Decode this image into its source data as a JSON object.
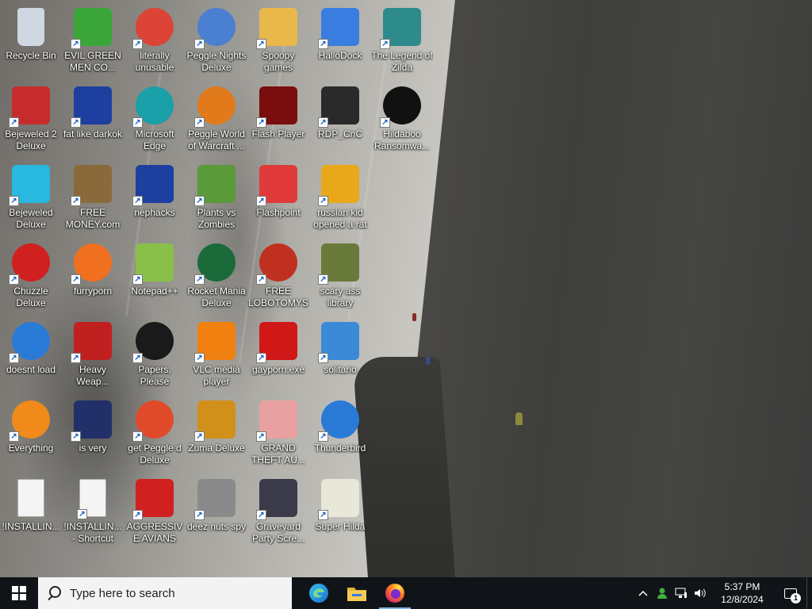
{
  "desktop": {
    "icons": [
      {
        "label": "Recycle Bin",
        "icon": "recycle-bin-icon",
        "color": "#cfd8e2"
      },
      {
        "label": "EVIL GREEN MEN CO...",
        "icon": "green-men-icon",
        "color": "#3aa63a"
      },
      {
        "label": "literally unusable",
        "icon": "chrome-icon",
        "color": "#db4437"
      },
      {
        "label": "Peggle Nights Deluxe",
        "icon": "peggle-icon",
        "color": "#4b7fd1"
      },
      {
        "label": "Spoopy games",
        "icon": "folder-icon",
        "color": "#e8b84a"
      },
      {
        "label": "HalloDock",
        "icon": "shield-icon",
        "color": "#3a7de0"
      },
      {
        "label": "The Legend of Zilda",
        "icon": "zilda-icon",
        "color": "#2e8b8b"
      },
      {
        "label": "Bejeweled 2 Deluxe",
        "icon": "bejeweled2-icon",
        "color": "#c72c2c"
      },
      {
        "label": "fat like darkok",
        "icon": "mpl-icon",
        "color": "#1c3fa0"
      },
      {
        "label": "Microsoft Edge",
        "icon": "edge-icon",
        "color": "#1aa0a8"
      },
      {
        "label": "Peggle World of Warcraft ...",
        "icon": "peggle-wow-icon",
        "color": "#e07a1a"
      },
      {
        "label": "Flash Player",
        "icon": "flash-icon",
        "color": "#7a0d0d"
      },
      {
        "label": "RDP_CnC",
        "icon": "rdp-icon",
        "color": "#2a2a2a"
      },
      {
        "label": "Hildaboo Ransomwa...",
        "icon": "yashma-icon",
        "color": "#111111"
      },
      {
        "label": "Bejeweled Deluxe",
        "icon": "diamond-icon",
        "color": "#28b8e0"
      },
      {
        "label": "FREE MONEY.com",
        "icon": "money-bag-icon",
        "color": "#8a6a3a"
      },
      {
        "label": "nephacks",
        "icon": "mpi-icon",
        "color": "#1c3fa0"
      },
      {
        "label": "Plants vs Zombies",
        "icon": "pvz-icon",
        "color": "#5a9a3a"
      },
      {
        "label": "Flashpoint",
        "icon": "flashpoint-icon",
        "color": "#e03a3a"
      },
      {
        "label": "russian kid opened a rat",
        "icon": "de-icon",
        "color": "#e8a81a"
      },
      {
        "label": "Chuzzle Deluxe",
        "icon": "chuzzle-icon",
        "color": "#d02020"
      },
      {
        "label": "furryporn",
        "icon": "firefox-icon",
        "color": "#f07020"
      },
      {
        "label": "Notepad++",
        "icon": "notepadpp-icon",
        "color": "#8ac04a"
      },
      {
        "label": "Rocket Mania Deluxe",
        "icon": "rocket-icon",
        "color": "#1a6a3a"
      },
      {
        "label": "FREE LOBOTOMYS",
        "icon": "lobotomy-icon",
        "color": "#c03020"
      },
      {
        "label": "scary ass library",
        "icon": "library-icon",
        "color": "#6a7a3a"
      },
      {
        "label": "doesnt load",
        "icon": "thunderbird-icon",
        "color": "#2a7ad8"
      },
      {
        "label": "Heavy Weap...",
        "icon": "radiation-icon",
        "color": "#c02020"
      },
      {
        "label": "Papers, Please",
        "icon": "papers-icon",
        "color": "#1a1a1a"
      },
      {
        "label": "VLC media player",
        "icon": "vlc-icon",
        "color": "#f08010"
      },
      {
        "label": "gayporn.exe",
        "icon": "flash-exe-icon",
        "color": "#d01818"
      },
      {
        "label": "solitario",
        "icon": "solitaire-icon",
        "color": "#3a8ad8"
      },
      {
        "label": "Everything",
        "icon": "everything-icon",
        "color": "#f08a1a"
      },
      {
        "label": "is very",
        "icon": "mpl-shield-icon",
        "color": "#22306a"
      },
      {
        "label": "get Peggle d Deluxe",
        "icon": "peggle-p-icon",
        "color": "#e04a2a"
      },
      {
        "label": "Zuma Deluxe",
        "icon": "zuma-icon",
        "color": "#d0901a"
      },
      {
        "label": "GRAND THEFT AU...",
        "icon": "gta-icon",
        "color": "#e8a0a0"
      },
      {
        "label": "Thunderbird",
        "icon": "thunderbird-icon",
        "color": "#2a7ad8"
      },
      {
        "label": "!INSTALLIN...",
        "icon": "text-file-icon",
        "color": "#f4f4f4"
      },
      {
        "label": "!INSTALLIN... - Shortcut",
        "icon": "text-file-icon",
        "color": "#f4f4f4"
      },
      {
        "label": "AGGRESSIVE AVIANS",
        "icon": "angry-bird-icon",
        "color": "#d02020"
      },
      {
        "label": "deez nuts spy",
        "icon": "windows-stack-icon",
        "color": "#8a8a8a"
      },
      {
        "label": "Graveyard Party Scre...",
        "icon": "graveyard-icon",
        "color": "#3a3a4a"
      },
      {
        "label": "Super Hilda",
        "icon": "hilda-icon",
        "color": "#e8e8d8"
      }
    ]
  },
  "taskbar": {
    "search_placeholder": "Type here to search",
    "pinned": [
      {
        "name": "Microsoft Edge",
        "icon": "edge-icon"
      },
      {
        "name": "File Explorer",
        "icon": "folder-icon"
      },
      {
        "name": "Firefox",
        "icon": "firefox-icon"
      }
    ],
    "tray": {
      "time": "5:37 PM",
      "date": "12/8/2024",
      "notification_count": "1"
    }
  }
}
